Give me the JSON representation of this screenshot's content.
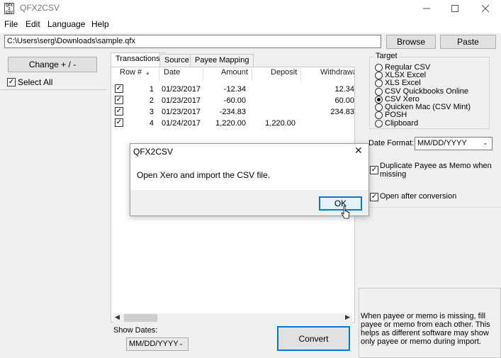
{
  "window": {
    "icon_text": "QFX2CSV",
    "title": "QFX2CSV",
    "minimize_icon": "minimize-icon",
    "maximize_icon": "maximize-icon",
    "close_icon": "close-icon"
  },
  "menu": {
    "items": [
      {
        "label": "File"
      },
      {
        "label": "Edit"
      },
      {
        "label": "Language"
      },
      {
        "label": "Help"
      }
    ]
  },
  "path": {
    "value": "C:\\Users\\serg\\Downloads\\sample.qfx",
    "browse_label": "Browse",
    "paste_label": "Paste"
  },
  "left": {
    "change_label": "Change + / -",
    "select_all_label": "Select All",
    "select_all_checked": true
  },
  "tabs": [
    {
      "label": "Transactions",
      "active": true
    },
    {
      "label": "Source"
    },
    {
      "label": "Payee Mapping"
    }
  ],
  "grid": {
    "headers": {
      "row": "Row #",
      "date": "Date",
      "amount": "Amount",
      "deposit": "Deposit",
      "withdrawal": "Withdrawal"
    },
    "rows": [
      {
        "checked": true,
        "row": "1",
        "date": "01/23/2017",
        "amount": "-12.34",
        "deposit": "",
        "withdrawal": "12.34"
      },
      {
        "checked": true,
        "row": "2",
        "date": "01/23/2017",
        "amount": "-60.00",
        "deposit": "",
        "withdrawal": "60.00"
      },
      {
        "checked": true,
        "row": "3",
        "date": "01/23/2017",
        "amount": "-234.83",
        "deposit": "",
        "withdrawal": "234.83"
      },
      {
        "checked": true,
        "row": "4",
        "date": "01/24/2017",
        "amount": "1,220.00",
        "deposit": "1,220.00",
        "withdrawal": ""
      }
    ]
  },
  "bottom": {
    "show_dates_label": "Show Dates:",
    "show_dates_value": "MM/DD/YYYY",
    "convert_label": "Convert"
  },
  "target": {
    "legend": "Target",
    "options": [
      {
        "label": "Regular CSV",
        "selected": false
      },
      {
        "label": "XLSX Excel",
        "selected": false
      },
      {
        "label": "XLS Excel",
        "selected": false
      },
      {
        "label": "CSV Quickbooks Online",
        "selected": false
      },
      {
        "label": "CSV Xero",
        "selected": true
      },
      {
        "label": "Quicken Mac (CSV Mint)",
        "selected": false
      },
      {
        "label": "POSH",
        "selected": false
      },
      {
        "label": "Clipboard",
        "selected": false
      }
    ]
  },
  "options": {
    "date_format_label": "Date Format:",
    "date_format_value": "MM/DD/YYYY",
    "dup_payee_label": "Duplicate Payee as Memo when missing",
    "dup_payee_checked": true,
    "open_after_label": "Open after conversion",
    "open_after_checked": true
  },
  "help_text": "When payee or memo is missing, fill payee or memo from each other. This helps as different software may show only payee or memo during import.",
  "dialog": {
    "title": "QFX2CSV",
    "message": "Open Xero and import the CSV file.",
    "ok_label": "OK"
  },
  "colors": {
    "accent": "#0078d7",
    "window_bg": "#f0f0f0",
    "button_bg": "#e1e1e1"
  }
}
